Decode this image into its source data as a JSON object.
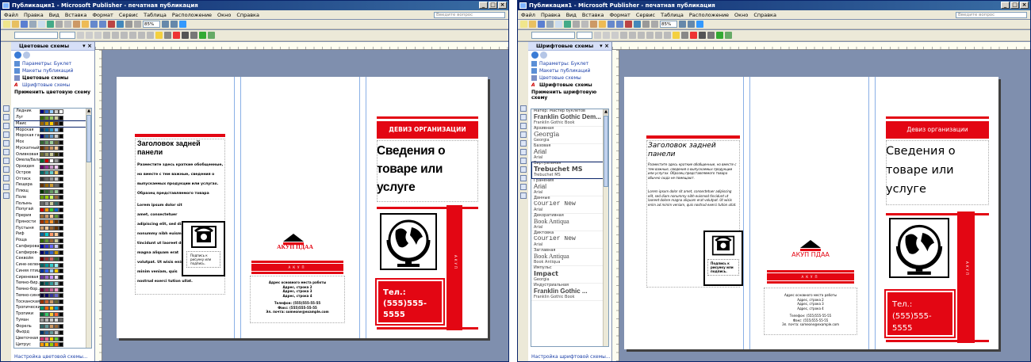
{
  "left": {
    "title": "Публикация1 - Microsoft Publisher - печатная публикация",
    "menu": [
      "Файл",
      "Правка",
      "Вид",
      "Вставка",
      "Формат",
      "Сервис",
      "Таблица",
      "Расположение",
      "Окно",
      "Справка"
    ],
    "ask": "Введите вопрос",
    "zoom": "85%",
    "taskpane_title": "Цветовые схемы",
    "links": [
      "Параметры: Буклет",
      "Макеты публикаций",
      "Цветовые схемы",
      "Шрифтовые схемы"
    ],
    "section": "Применить цветовую схему",
    "bottom_link": "Настройка цветовой схемы...",
    "schemes": [
      {
        "name": "Ледник",
        "c": [
          "#000080",
          "#3366cc",
          "#99ccff",
          "#cccccc",
          "#ffffff"
        ]
      },
      {
        "name": "Луг",
        "c": [
          "#336600",
          "#669933",
          "#99cc66",
          "#cccc99",
          "#000000"
        ]
      },
      {
        "name": "Маис",
        "c": [
          "#996600",
          "#cc9900",
          "#ffcc00",
          "#663300",
          "#000000"
        ]
      },
      {
        "name": "Морская",
        "c": [
          "#003366",
          "#006699",
          "#3399cc",
          "#99ccff",
          "#000000"
        ]
      },
      {
        "name": "Морская гавань",
        "c": [
          "#000066",
          "#336699",
          "#6699cc",
          "#cccccc",
          "#000000"
        ]
      },
      {
        "name": "Мох",
        "c": [
          "#336633",
          "#669966",
          "#99cc99",
          "#666633",
          "#000000"
        ]
      },
      {
        "name": "Мускатный...",
        "c": [
          "#663300",
          "#996633",
          "#cc9966",
          "#ffcc99",
          "#000000"
        ]
      },
      {
        "name": "Оливковая",
        "c": [
          "#666633",
          "#999966",
          "#cccc99",
          "#333300",
          "#000000"
        ]
      },
      {
        "name": "Омела/балая",
        "c": [
          "#006633",
          "#cc0000",
          "#ffffff",
          "#999999",
          "#000000"
        ]
      },
      {
        "name": "Орхидея",
        "c": [
          "#660066",
          "#993399",
          "#cc99cc",
          "#ffccff",
          "#000000"
        ]
      },
      {
        "name": "Остров",
        "c": [
          "#006666",
          "#339999",
          "#66cccc",
          "#ffcc66",
          "#000000"
        ]
      },
      {
        "name": "Оттиск",
        "c": [
          "#333333",
          "#666666",
          "#999999",
          "#cccccc",
          "#000000"
        ]
      },
      {
        "name": "Пещера",
        "c": [
          "#663300",
          "#996600",
          "#cc9933",
          "#666666",
          "#000000"
        ]
      },
      {
        "name": "Плющ",
        "c": [
          "#003300",
          "#336633",
          "#669966",
          "#99cc99",
          "#000000"
        ]
      },
      {
        "name": "Поле",
        "c": [
          "#669900",
          "#99cc00",
          "#ccff66",
          "#996633",
          "#000000"
        ]
      },
      {
        "name": "Полынь",
        "c": [
          "#666666",
          "#999999",
          "#cccc99",
          "#336666",
          "#000000"
        ]
      },
      {
        "name": "Попугай",
        "c": [
          "#cc0000",
          "#ff9900",
          "#33cc33",
          "#0066cc",
          "#000000"
        ]
      },
      {
        "name": "Прерия",
        "c": [
          "#996633",
          "#cc9966",
          "#ffcc99",
          "#669933",
          "#000000"
        ]
      },
      {
        "name": "Пряности",
        "c": [
          "#993300",
          "#cc6600",
          "#ff9933",
          "#663300",
          "#000000"
        ]
      },
      {
        "name": "Пустыня",
        "c": [
          "#cc9966",
          "#ffcc99",
          "#996633",
          "#663300",
          "#000000"
        ]
      },
      {
        "name": "Риф",
        "c": [
          "#006699",
          "#00cccc",
          "#ff9966",
          "#ffcc99",
          "#000000"
        ]
      },
      {
        "name": "Роща",
        "c": [
          "#336600",
          "#669933",
          "#996633",
          "#cccc99",
          "#000000"
        ]
      },
      {
        "name": "Сапфировая",
        "c": [
          "#000099",
          "#3333cc",
          "#6666ff",
          "#ccccff",
          "#000000"
        ]
      },
      {
        "name": "Сапфиров-...",
        "c": [
          "#000066",
          "#003399",
          "#3366cc",
          "#cc9900",
          "#000000"
        ]
      },
      {
        "name": "Секвойя",
        "c": [
          "#660000",
          "#993333",
          "#cc6666",
          "#336633",
          "#000000"
        ]
      },
      {
        "name": "Сине-зеленая",
        "c": [
          "#006666",
          "#009999",
          "#33cccc",
          "#99ffff",
          "#000000"
        ]
      },
      {
        "name": "Синяя птица",
        "c": [
          "#003399",
          "#3366ff",
          "#99ccff",
          "#ffcc00",
          "#000000"
        ]
      },
      {
        "name": "Сиреневая",
        "c": [
          "#663399",
          "#9966cc",
          "#cc99ff",
          "#eeddff",
          "#000000"
        ]
      },
      {
        "name": "Темно-бир...",
        "c": [
          "#003333",
          "#006666",
          "#339999",
          "#99cccc",
          "#000000"
        ]
      },
      {
        "name": "Темно-бор...",
        "c": [
          "#660033",
          "#993366",
          "#cc6699",
          "#ff99cc",
          "#000000"
        ]
      },
      {
        "name": "Темно-синяя",
        "c": [
          "#000033",
          "#000066",
          "#333399",
          "#6666cc",
          "#000000"
        ]
      },
      {
        "name": "Тосканская",
        "c": [
          "#993300",
          "#cc6633",
          "#cc9966",
          "#666633",
          "#000000"
        ]
      },
      {
        "name": "Тропический",
        "c": [
          "#009966",
          "#ff6600",
          "#ffcc00",
          "#0099cc",
          "#000000"
        ]
      },
      {
        "name": "Тропики",
        "c": [
          "#006633",
          "#33cc66",
          "#ffcc33",
          "#ff6633",
          "#000000"
        ]
      },
      {
        "name": "Туман",
        "c": [
          "#999999",
          "#bbbbbb",
          "#cccccc",
          "#dddddd",
          "#666666"
        ]
      },
      {
        "name": "Форель",
        "c": [
          "#336666",
          "#669999",
          "#cc9966",
          "#996633",
          "#000000"
        ]
      },
      {
        "name": "Фьорд",
        "c": [
          "#003366",
          "#336699",
          "#669999",
          "#cccccc",
          "#000000"
        ]
      },
      {
        "name": "Цветочная",
        "c": [
          "#cc3366",
          "#ff6699",
          "#ffcc00",
          "#66cc33",
          "#000000"
        ]
      },
      {
        "name": "Цитрус",
        "c": [
          "#ff9900",
          "#ffcc00",
          "#99cc00",
          "#ff6600",
          "#000000"
        ]
      },
      {
        "name": "Черно-белая",
        "c": [
          "#000000",
          "#333333",
          "#666666",
          "#ffffff",
          "#000000"
        ]
      }
    ],
    "doc": {
      "back_title": "Заголовок задней панели",
      "back_text1": "Разместите здесь краткие обобщенные, но вместе с тем важные, сведения о выпускаемых продукции или услугах. Образец представляемого товара обычно сюда не помещают.",
      "back_text2": "Lorem ipsum dolor sit amet, consectetuer adipiscing elit, sed diam nonummy nibh euismod tincidunt ut laoreet dolore magna aliquam erat volutpat. Ut wisis enim ad minim veniam, quis nostrud exerci tution ullat.",
      "caption": "Подпись к рисунку или подпись.",
      "org": "АКУП ПДАА",
      "address_label": "Адрес основного места работы",
      "address_lines": [
        "Адрес, строка 2",
        "Адрес, строка 3",
        "Адрес, строка 4"
      ],
      "phone_line": "Телефон: (555)555-55-55",
      "fax_line": "Факс: (555)555-55-55",
      "email_line": "Эл. почта: someone@example.com",
      "motto": "ДЕВИЗ ОРГАНИЗАЦИИ",
      "headline": "Сведения о товаре или услуге",
      "phone_big": "Тел.: (555)555-5555",
      "vertical": "АКУП",
      "band_text": "АКУП"
    }
  },
  "right": {
    "title": "Публикация1 - Microsoft Publisher - печатная публикация",
    "ask": "Введите вопрос",
    "zoom": "85%",
    "taskpane_title": "Шрифтовые схемы",
    "links": [
      "Параметры: Буклет",
      "Макеты публикаций",
      "Цветовые схемы",
      "Шрифтовые схемы"
    ],
    "section": "Применить шрифтовую схему",
    "bottom_link": "Настройка шрифтовой схемы...",
    "fonts": [
      {
        "name": "Матер: Мастер буклетов",
        "f1": "Franklin Gothic Dem...",
        "f2": "Franklin Gothic Book",
        "ff": "'Liberation Sans',sans-serif",
        "w": "bold",
        "st": "normal"
      },
      {
        "name": "Архивная",
        "f1": "Georgia",
        "f2": "Georgia",
        "ff": "'DejaVu Serif',serif",
        "w": "normal",
        "st": "normal"
      },
      {
        "name": "Базовая",
        "f1": "Arial",
        "f2": "Arial",
        "ff": "'Liberation Sans',sans-serif",
        "w": "normal",
        "st": "normal"
      },
      {
        "name": "Виртуальная",
        "f1": "Trebuchet MS",
        "f2": "Trebuchet MS",
        "ff": "'DejaVu Sans',sans-serif",
        "w": "bold",
        "st": "normal"
      },
      {
        "name": "Гранения",
        "f1": "Arial",
        "f2": "Arial",
        "ff": "'Liberation Sans',sans-serif",
        "w": "normal",
        "st": "normal"
      },
      {
        "name": "Данные",
        "f1": "Courier New",
        "f2": "Arial",
        "ff": "'Liberation Mono',monospace",
        "w": "normal",
        "st": "normal"
      },
      {
        "name": "Декоративная",
        "f1": "Book Antiqua",
        "f2": "Arial",
        "ff": "'Liberation Serif',serif",
        "w": "normal",
        "st": "normal"
      },
      {
        "name": "Диктовка",
        "f1": "Courier New",
        "f2": "Arial",
        "ff": "'Liberation Mono',monospace",
        "w": "normal",
        "st": "normal"
      },
      {
        "name": "Заглавная",
        "f1": "Book Antiqua",
        "f2": "Book Antiqua",
        "ff": "'Liberation Serif',serif",
        "w": "normal",
        "st": "normal"
      },
      {
        "name": "Импульс",
        "f1": "Impact",
        "f2": "Georgia",
        "ff": "'DejaVu Sans',sans-serif",
        "w": "bold",
        "st": "normal"
      },
      {
        "name": "Индустриальная",
        "f1": "Franklin Gothic ...",
        "f2": "Franklin Gothic Book",
        "ff": "'Liberation Sans',sans-serif",
        "w": "bold",
        "st": "normal"
      }
    ],
    "doc": {
      "back_title": "Заголовок задней панели",
      "back_text1": "Разместите здесь краткие обобщенные, но вместе с тем важные, сведения о выпускаемых продукции или услугах. Образец представляемого товара обычно сюда не помещают.",
      "back_text2": "Lorem ipsum dolor sit amet, consectetuer adipiscing elit, sed diam nonummy nibh euismod tincidunt ut laoreet dolore magna aliquam erat volutpat. Ut wisis enim ad minim veniam, quis nostrud exerci tution ullat.",
      "caption": "Подпись к рисунку или подпись.",
      "org": "АКУП ПДАА",
      "address_label": "Адрес основного места работы",
      "address_lines": [
        "Адрес, строка 2",
        "Адрес, строка 3",
        "Адрес, строка 4"
      ],
      "phone_line": "Телефон: (555)555-55-55",
      "fax_line": "Факс: (555)555-55-55",
      "email_line": "Эл. почта: someone@example.com",
      "motto": "Девиз организации",
      "headline": "Сведения о товаре или услуге",
      "phone_big": "Тел.: (555)555-5555",
      "vertical": "АКУП",
      "band_text": "АКУП"
    }
  },
  "colors": {
    "accent": "#e30613",
    "workspace": "#7f8fae",
    "titlebar": "#0a246a"
  }
}
